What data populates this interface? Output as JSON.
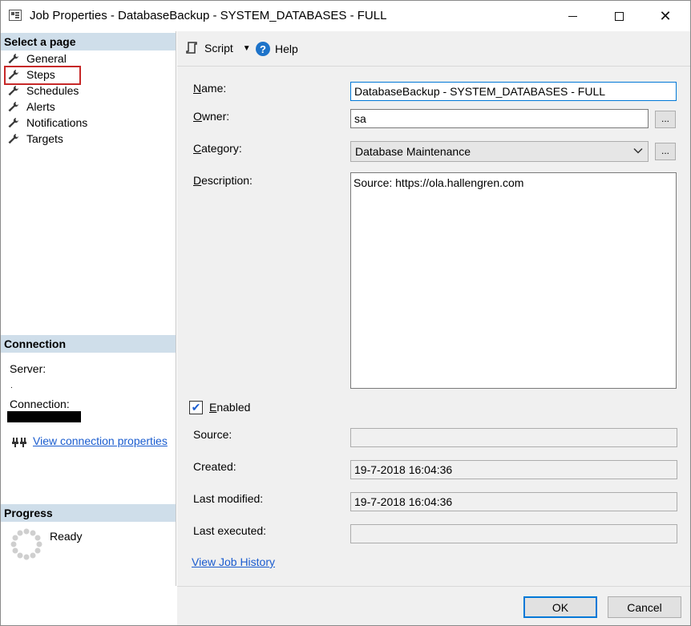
{
  "window": {
    "title": "Job Properties - DatabaseBackup - SYSTEM_DATABASES - FULL"
  },
  "left": {
    "select_header": "Select a page",
    "pages": [
      {
        "label": "General",
        "icon": "wrench-icon"
      },
      {
        "label": "Steps",
        "icon": "wrench-icon",
        "selected": true
      },
      {
        "label": "Schedules",
        "icon": "wrench-icon"
      },
      {
        "label": "Alerts",
        "icon": "wrench-icon"
      },
      {
        "label": "Notifications",
        "icon": "wrench-icon"
      },
      {
        "label": "Targets",
        "icon": "wrench-icon"
      }
    ],
    "connection_header": "Connection",
    "server_label": "Server:",
    "server_value": ".",
    "connection_label": "Connection:",
    "view_connection_link": "View connection properties",
    "progress_header": "Progress",
    "progress_status": "Ready"
  },
  "toolbar": {
    "script_label": "Script",
    "help_label": "Help"
  },
  "form": {
    "name_label": "Name:",
    "name_value": "DatabaseBackup - SYSTEM_DATABASES - FULL",
    "owner_label": "Owner:",
    "owner_value": "sa",
    "category_label": "Category:",
    "category_value": "Database Maintenance",
    "description_label": "Description:",
    "description_value": "Source: https://ola.hallengren.com",
    "enabled_label": "Enabled",
    "enabled": true,
    "source_label": "Source:",
    "source_value": "",
    "created_label": "Created:",
    "created_value": "19-7-2018 16:04:36",
    "modified_label": "Last modified:",
    "modified_value": "19-7-2018 16:04:36",
    "executed_label": "Last executed:",
    "executed_value": "",
    "history_link": "View Job History",
    "browse_label": "..."
  },
  "footer": {
    "ok_label": "OK",
    "cancel_label": "Cancel"
  },
  "colors": {
    "section_header": "#cfdeea",
    "selection_outline": "#c62828",
    "link": "#1a5ccf",
    "focus": "#0078d7"
  }
}
